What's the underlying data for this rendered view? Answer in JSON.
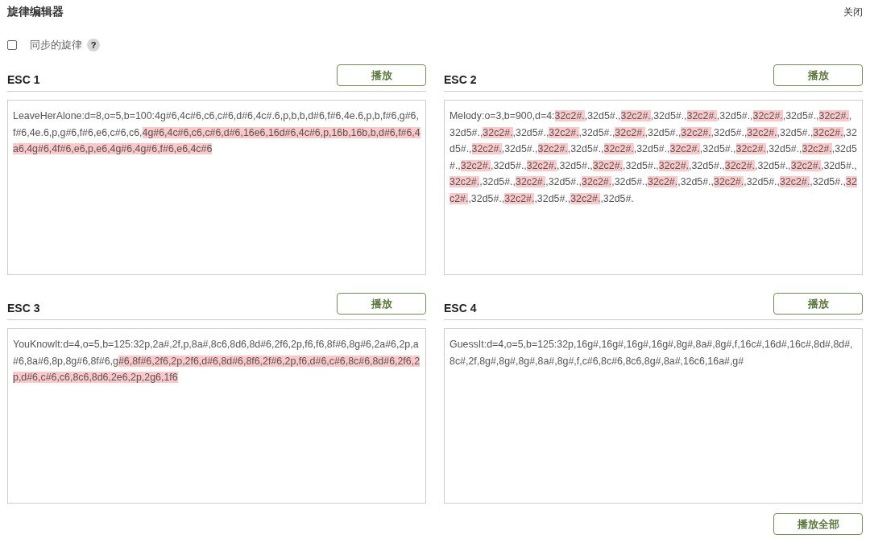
{
  "title": "旋律编辑器",
  "close": "关闭",
  "sync": {
    "label": "同步的旋律",
    "checked": false,
    "help": "?"
  },
  "panels": [
    {
      "title": "ESC 1",
      "button": "播放",
      "segments": [
        {
          "text": "LeaveHerAlone:d=8,o=5,b=100:4g#6,4c#6,c6,c#6,d#6,4c#.6,p,b,b,d#6,f#6,4e.6,p,b,f#6,g#6,f#6,4e.6,p,g#6,f#6,e6,c#6,c6,",
          "highlighted": false
        },
        {
          "text": "4g#6,4c#6,c6,c#6,d#6,16e6,16d#6,4c#6,p,16b,16b,b,d#6,f#6,4a6,4g#6,4f#6,e6,p,e6,4g#6,4g#6,f#6,e6,4c#6",
          "highlighted": true
        }
      ]
    },
    {
      "title": "ESC 2",
      "button": "播放",
      "segments": [
        {
          "text": "Melody:o=3,b=900,d=4:",
          "highlighted": false
        },
        {
          "text": "32c2#.",
          "highlighted": true
        },
        {
          "text": ",32d5#.,",
          "highlighted": false
        },
        {
          "text": "32c2#.",
          "highlighted": true
        },
        {
          "text": ",32d5#.,",
          "highlighted": false
        },
        {
          "text": "32c2#.",
          "highlighted": true
        },
        {
          "text": ",32d5#.,",
          "highlighted": false
        },
        {
          "text": "32c2#.",
          "highlighted": true
        },
        {
          "text": ",32d5#.,",
          "highlighted": false
        },
        {
          "text": "32c2#.",
          "highlighted": true
        },
        {
          "text": ",32d5#.,",
          "highlighted": false
        },
        {
          "text": "32c2#.",
          "highlighted": true
        },
        {
          "text": ",32d5#.,",
          "highlighted": false
        },
        {
          "text": "32c2#.",
          "highlighted": true
        },
        {
          "text": ",32d5#.,",
          "highlighted": false
        },
        {
          "text": "32c2#.",
          "highlighted": true
        },
        {
          "text": ",32d5#.,",
          "highlighted": false
        },
        {
          "text": "32c2#.",
          "highlighted": true
        },
        {
          "text": ",32d5#.,",
          "highlighted": false
        },
        {
          "text": "32c2#.",
          "highlighted": true
        },
        {
          "text": ",32d5#.,",
          "highlighted": false
        },
        {
          "text": "32c2#.",
          "highlighted": true
        },
        {
          "text": ",32d5#.,",
          "highlighted": false
        },
        {
          "text": "32c2#.",
          "highlighted": true
        },
        {
          "text": ",32d5#.,",
          "highlighted": false
        },
        {
          "text": "32c2#.",
          "highlighted": true
        },
        {
          "text": ",32d5#.,",
          "highlighted": false
        },
        {
          "text": "32c2#.",
          "highlighted": true
        },
        {
          "text": ",32d5#.,",
          "highlighted": false
        },
        {
          "text": "32c2#.",
          "highlighted": true
        },
        {
          "text": ",32d5#.,",
          "highlighted": false
        },
        {
          "text": "32c2#.",
          "highlighted": true
        },
        {
          "text": ",32d5#.,",
          "highlighted": false
        },
        {
          "text": "32c2#.",
          "highlighted": true
        },
        {
          "text": ",32d5#.,",
          "highlighted": false
        },
        {
          "text": "32c2#.",
          "highlighted": true
        },
        {
          "text": ",32d5#.,",
          "highlighted": false
        },
        {
          "text": "32c2#.",
          "highlighted": true
        },
        {
          "text": ",32d5#.,",
          "highlighted": false
        },
        {
          "text": "32c2#.",
          "highlighted": true
        },
        {
          "text": ",32d5#.,",
          "highlighted": false
        },
        {
          "text": "32c2#.",
          "highlighted": true
        },
        {
          "text": ",32d5#.,",
          "highlighted": false
        },
        {
          "text": "32c2#.",
          "highlighted": true
        },
        {
          "text": ",32d5#.,",
          "highlighted": false
        },
        {
          "text": "32c2#.",
          "highlighted": true
        },
        {
          "text": ",32d5#.,",
          "highlighted": false
        },
        {
          "text": "32c2#.",
          "highlighted": true
        },
        {
          "text": ",32d5#.,",
          "highlighted": false
        },
        {
          "text": "32c2#.",
          "highlighted": true
        },
        {
          "text": ",32d5#.,",
          "highlighted": false
        },
        {
          "text": "32c2#.",
          "highlighted": true
        },
        {
          "text": ",32d5#.,",
          "highlighted": false
        },
        {
          "text": "32c2#.",
          "highlighted": true
        },
        {
          "text": ",32d5#.,",
          "highlighted": false
        },
        {
          "text": "32c2#.",
          "highlighted": true
        },
        {
          "text": ",32d5#.,",
          "highlighted": false
        },
        {
          "text": "32c2#.",
          "highlighted": true
        },
        {
          "text": ",32d5#.,",
          "highlighted": false
        },
        {
          "text": "32c2#.",
          "highlighted": true
        },
        {
          "text": ",32d5#.,",
          "highlighted": false
        },
        {
          "text": "32c2#.",
          "highlighted": true
        },
        {
          "text": ",32d5#.,",
          "highlighted": false
        },
        {
          "text": "32c2#.",
          "highlighted": true
        },
        {
          "text": ",32d5#.",
          "highlighted": false
        }
      ]
    },
    {
      "title": "ESC 3",
      "button": "播放",
      "segments": [
        {
          "text": "YouKnowIt:d=4,o=5,b=125:32p,2a#,2f,p,8a#,8c6,8d6,8d#6,2f6,2p,f6,f6,8f#6,8g#6,2a#6,2p,a#6,8a#6,8p,8g#6,8f#6,g",
          "highlighted": false
        },
        {
          "text": "#6,8f#6,2f6,2p,2f6,d#6,8d#6,8f6,2f#6,2p,f6,d#6,c#6,8c#6,8d#6,2f6,2p,d#6,c#6,c6,8c6,8d6,2e6,2p,2g6,1f6",
          "highlighted": true
        }
      ]
    },
    {
      "title": "ESC 4",
      "button": "播放",
      "segments": [
        {
          "text": "GuessIt:d=4,o=5,b=125:32p,16g#,16g#,16g#,16g#,8g#,8a#,8g#,f,16c#,16d#,16c#,8d#,8d#,8c#,2f,8g#,8g#,8g#,8a#,8g#,f,c#6,8c#6,8c6,8g#,8a#,16c6,16a#,g#",
          "highlighted": false
        }
      ]
    }
  ],
  "play_all": "播放全部"
}
